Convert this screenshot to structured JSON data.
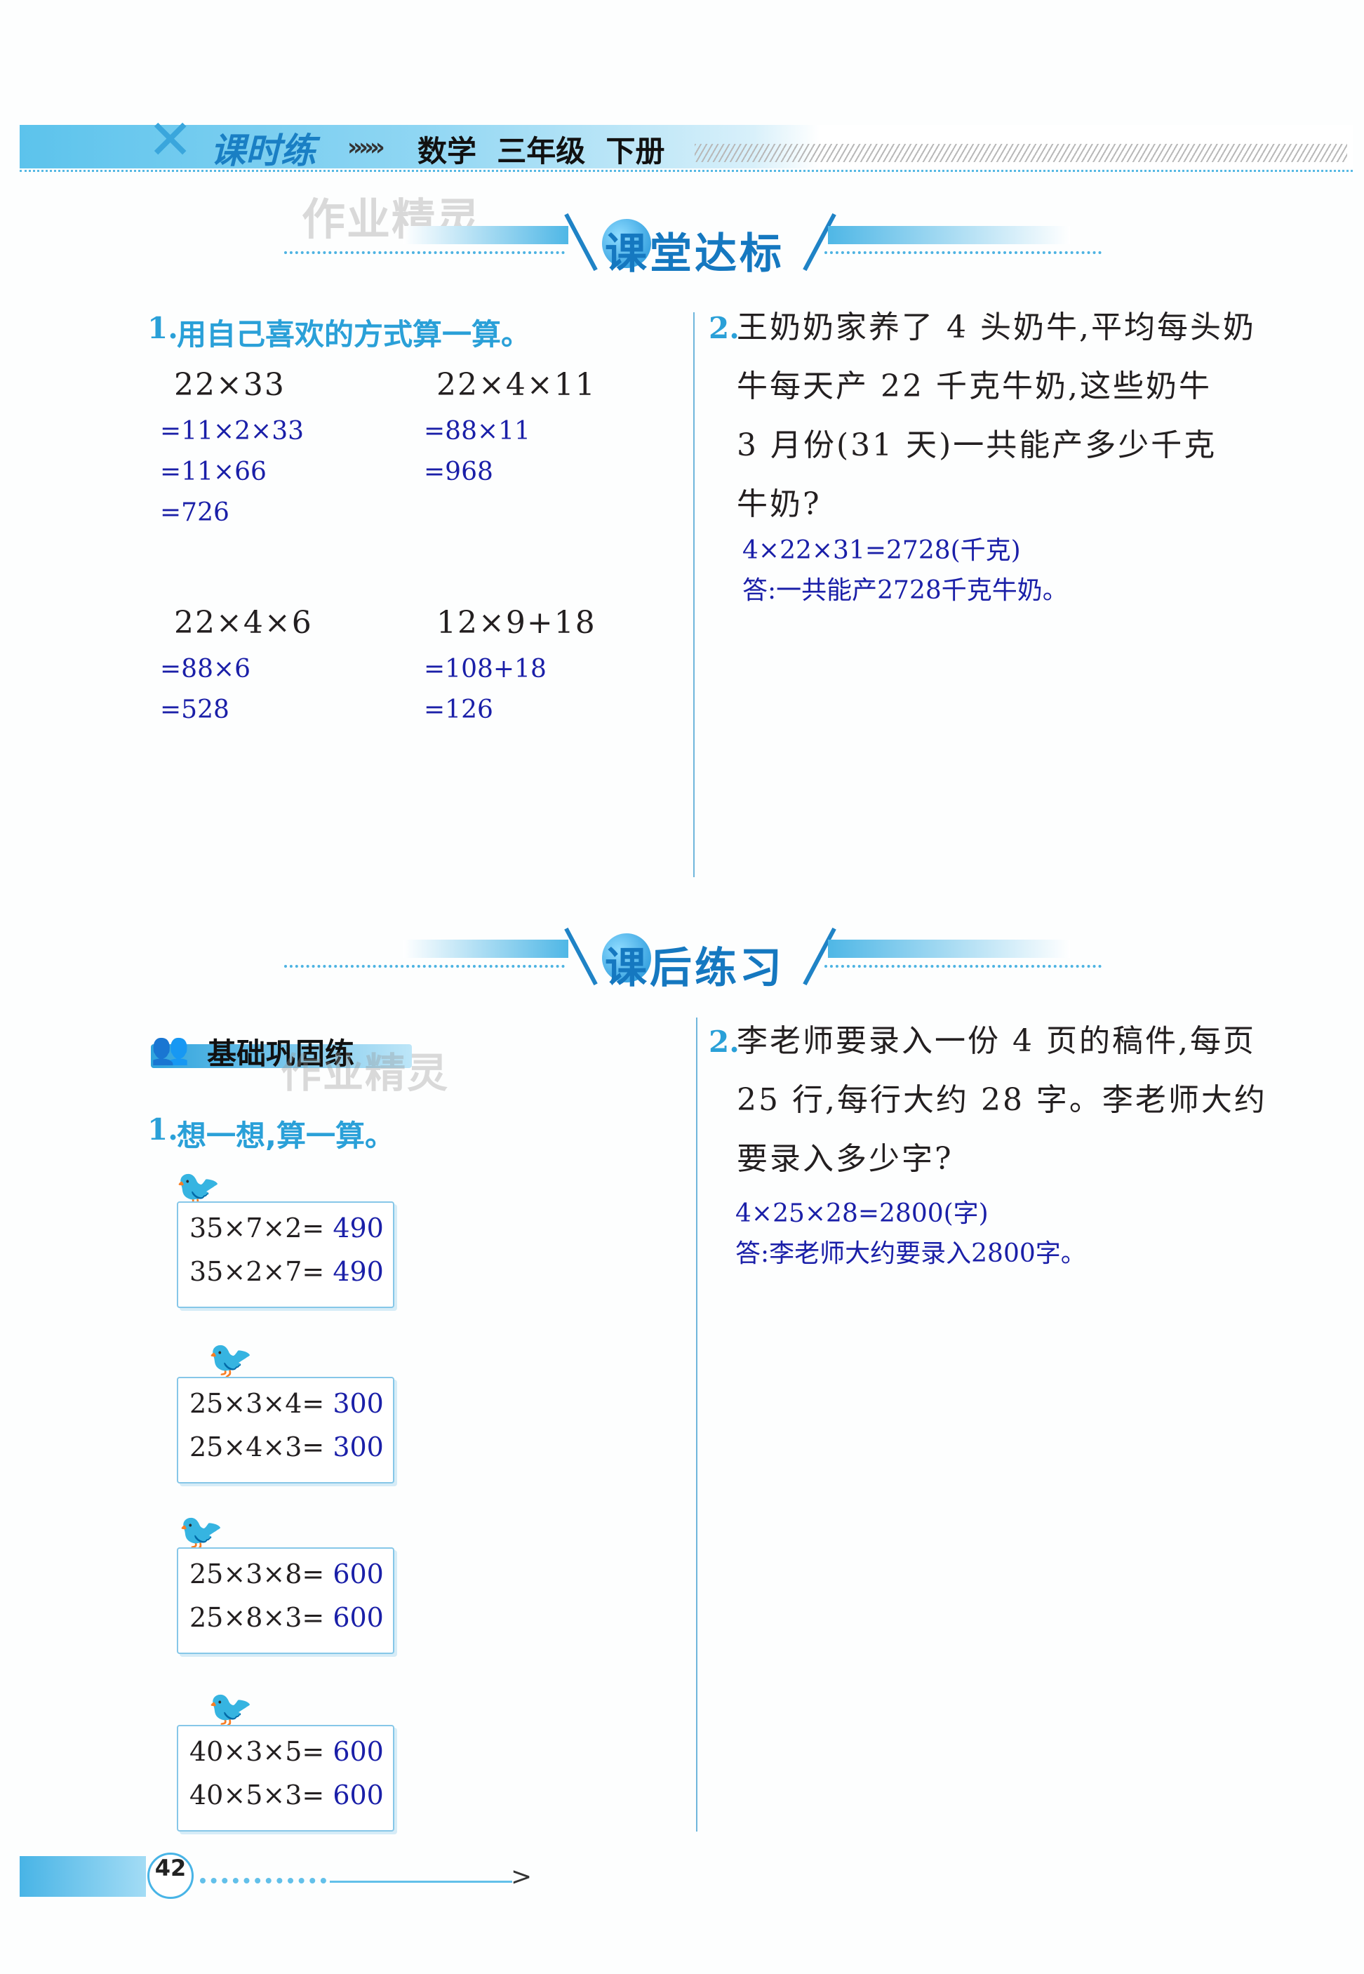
{
  "header": {
    "brand": "课时练",
    "arrows": "»»»",
    "subject": "数学  三年级  下册",
    "watermark": "作业精灵"
  },
  "section1": {
    "title": "课堂达标",
    "q1": {
      "number": "1.",
      "prompt": "用自己喜欢的方式算一算。",
      "items": [
        {
          "expr": "22×33",
          "steps": [
            "=11×2×33",
            "=11×66",
            "=726"
          ]
        },
        {
          "expr": "22×4×11",
          "steps": [
            "=88×11",
            "=968"
          ]
        },
        {
          "expr": "22×4×6",
          "steps": [
            "=88×6",
            "=528"
          ]
        },
        {
          "expr": "12×9+18",
          "steps": [
            "=108+18",
            "=126"
          ]
        }
      ]
    },
    "q2": {
      "number": "2.",
      "lines": [
        "王奶奶家养了 4 头奶牛,平均每头奶",
        "牛每天产 22 千克牛奶,这些奶牛",
        "3 月份(31 天)一共能产多少千克",
        "牛奶?"
      ],
      "answers": [
        "4×22×31=2728(千克)",
        "答:一共能产2728千克牛奶。"
      ]
    }
  },
  "section2": {
    "title": "课后练习",
    "badge": "基础巩固练",
    "watermark": "作业精灵",
    "q1": {
      "number": "1.",
      "prompt": "想一想,算一算。",
      "boxes": [
        {
          "bird": "🐦",
          "rows": [
            {
              "expr": "35×7×2=",
              "ans": "490"
            },
            {
              "expr": "35×2×7=",
              "ans": "490"
            }
          ]
        },
        {
          "bird": "🐦",
          "rows": [
            {
              "expr": "25×3×4=",
              "ans": "300"
            },
            {
              "expr": "25×4×3=",
              "ans": "300"
            }
          ]
        },
        {
          "bird": "🐦",
          "rows": [
            {
              "expr": "25×3×8=",
              "ans": "600"
            },
            {
              "expr": "25×8×3=",
              "ans": "600"
            }
          ]
        },
        {
          "bird": "🐦",
          "rows": [
            {
              "expr": "40×3×5=",
              "ans": "600"
            },
            {
              "expr": "40×5×3=",
              "ans": "600"
            }
          ]
        }
      ]
    },
    "q2": {
      "number": "2.",
      "lines": [
        "李老师要录入一份 4 页的稿件,每页",
        "25 行,每行大约 28 字。李老师大约",
        "要录入多少字?"
      ],
      "answers": [
        "4×25×28=2800(字)",
        "答:李老师大约要录入2800字。"
      ]
    }
  },
  "footer": {
    "page_number": "42",
    "arrow": ">"
  },
  "colors": {
    "accent": "#2aa0d8",
    "answer": "#1a1fa8",
    "brand": "#1a7fc4"
  }
}
